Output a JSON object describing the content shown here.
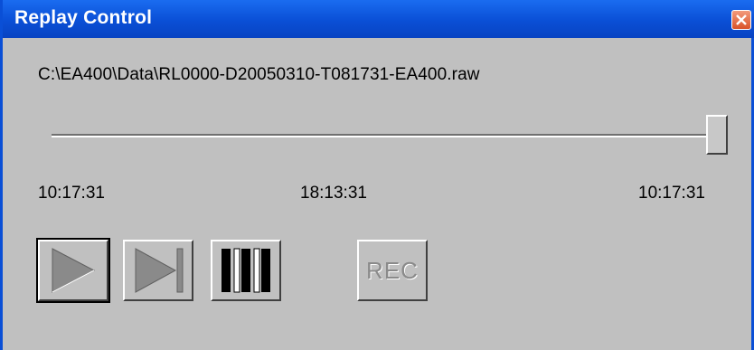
{
  "window": {
    "title": "Replay Control"
  },
  "file": {
    "path": "C:\\EA400\\Data\\RL0000-D20050310-T081731-EA400.raw"
  },
  "slider": {
    "position_fraction": 1.0
  },
  "times": {
    "start": "10:17:31",
    "middle": "18:13:31",
    "end": "10:17:31"
  },
  "buttons": {
    "play_icon": "play-icon",
    "step_icon": "step-forward-icon",
    "pause_icon": "pause-icon",
    "rec_label": "REC"
  },
  "colors": {
    "titlebar": "#0a4fd6",
    "window_bg": "#c0c0c0",
    "disabled_glyph": "#8a8a8a"
  }
}
